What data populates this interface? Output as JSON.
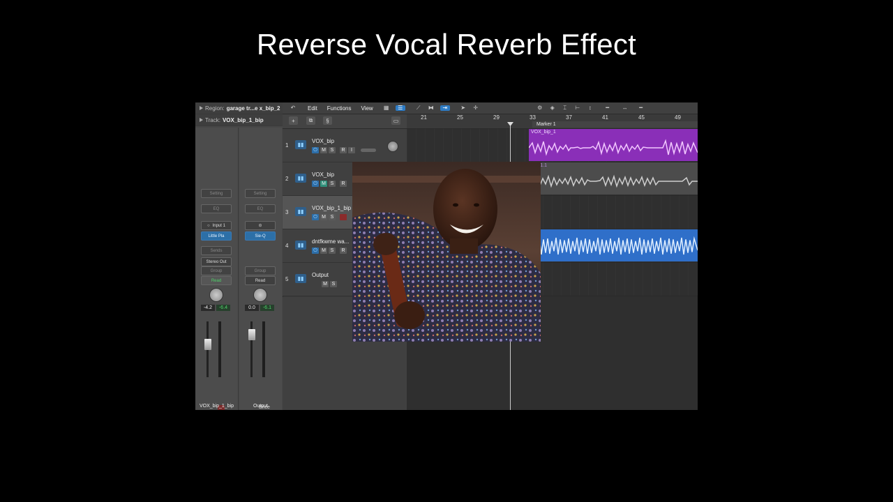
{
  "title": "Reverse Vocal Reverb Effect",
  "inspector": {
    "region_label": "Region:",
    "region_value": "garage tr...e x_bip_2",
    "track_label": "Track:",
    "track_value": "VOX_bip_1_bip",
    "strip1": {
      "setting": "Setting",
      "eq": "EQ",
      "input": "Input 1",
      "plugin": "Little Pla",
      "sends": "Sends",
      "output": "Stereo Out",
      "group": "Group",
      "automation": "Read",
      "volume": "-4.2",
      "peak": "-6.4",
      "mute": "M",
      "solo": "S",
      "name": "VOX_bip_1_bip"
    },
    "strip2": {
      "setting": "Setting",
      "eq": "EQ",
      "plugin": "Sie-Q",
      "group": "Group",
      "automation": "Read",
      "volume": "0.0",
      "peak": "-6.1",
      "bounce": "Bnce",
      "mute": "M",
      "solo": "S",
      "name": "Output"
    }
  },
  "toolbar": {
    "edit": "Edit",
    "functions": "Functions",
    "view": "View"
  },
  "tracks": [
    {
      "num": "1",
      "name": "VOX_bip",
      "mute": "M",
      "solo": "S",
      "rec": "R",
      "input": "I"
    },
    {
      "num": "2",
      "name": "VOX_bip",
      "mute": "M",
      "solo": "S",
      "rec": "R"
    },
    {
      "num": "3",
      "name": "VOX_bip_1_bip",
      "mute": "M",
      "solo": "S"
    },
    {
      "num": "4",
      "name": "dntfkwme wa...",
      "mute": "M",
      "solo": "S",
      "rec": "R"
    },
    {
      "num": "5",
      "name": "Output",
      "mute": "M",
      "solo": "S"
    }
  ],
  "ruler": {
    "bars": [
      "21",
      "25",
      "29",
      "33",
      "37",
      "41",
      "45",
      "49"
    ],
    "marker": "Marker 1"
  },
  "regions": [
    {
      "name": "VOX_bip_1",
      "color": "#8a2fb8"
    },
    {
      "name": "bip_1.1",
      "color": "#555555"
    },
    {
      "name": "",
      "color": "#2f6fc9"
    }
  ]
}
